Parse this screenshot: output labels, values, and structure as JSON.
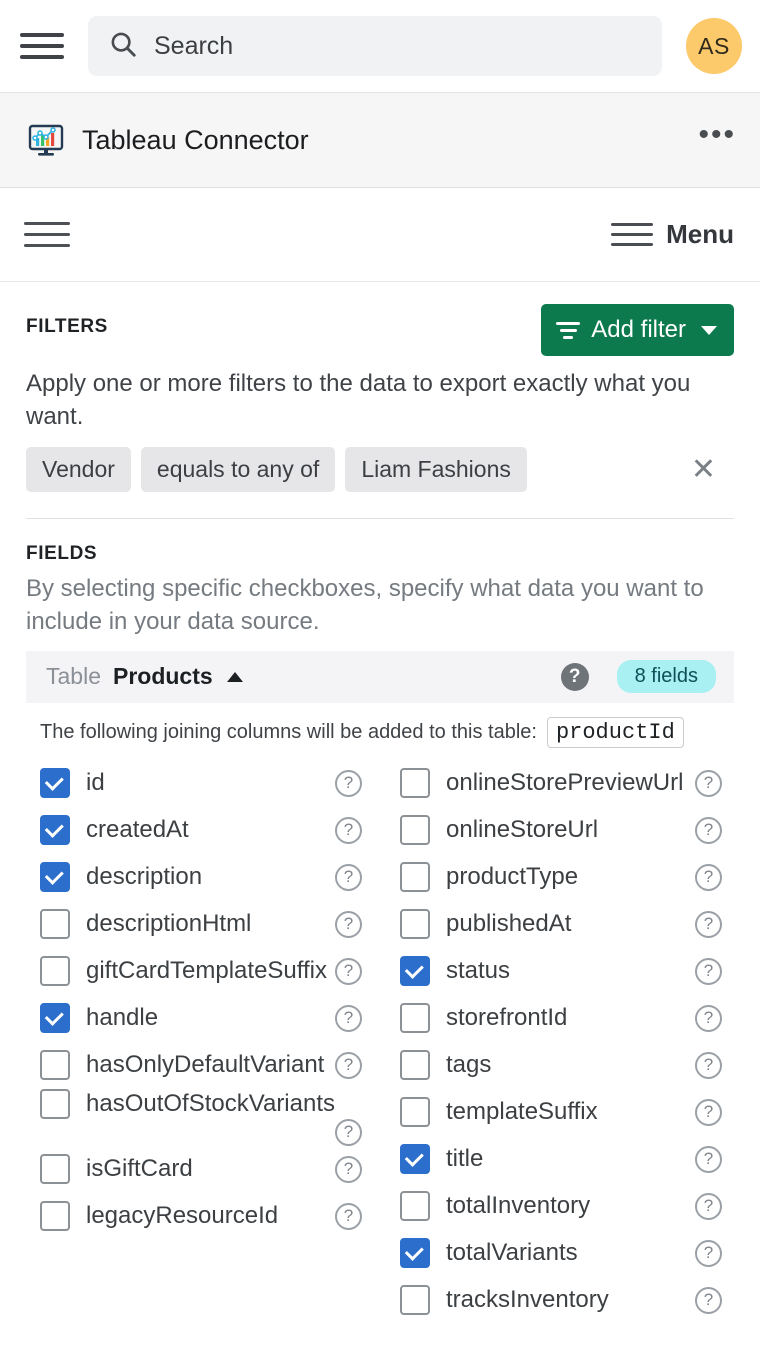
{
  "appbar": {
    "menu_icon": "hamburger-icon",
    "search": {
      "placeholder": "Search",
      "value": "",
      "icon": "search-icon"
    },
    "avatar": {
      "initials": "AS",
      "color": "#fcc96b"
    }
  },
  "titlebar": {
    "icon": "tableau-connector-icon",
    "title": "Tableau Connector",
    "overflow": "•••"
  },
  "toolbar": {
    "left_menu_icon": "hamburger-icon",
    "menu_label": "Menu"
  },
  "filters": {
    "section_title": "FILTERS",
    "add_button": "Add filter",
    "description": "Apply one or more filters to the data to export exactly what you want.",
    "chips": [
      {
        "label": "Vendor"
      },
      {
        "label": "equals to any of"
      },
      {
        "label": "Liam Fashions"
      }
    ],
    "remove_label": "✕",
    "accent_color": "#0c7a4d"
  },
  "fields": {
    "section_title": "FIELDS",
    "description": "By selecting specific checkboxes, specify what data you want to include in your data source.",
    "table": {
      "label": "Table",
      "name": "Products",
      "badge": "8 fields",
      "badge_color": "#a9f0f3",
      "help": "?"
    },
    "join_note": "The following joining columns will be added to this table:",
    "join_column": "productId",
    "help_glyph": "?",
    "left_column": [
      {
        "name": "id",
        "checked": true
      },
      {
        "name": "createdAt",
        "checked": true
      },
      {
        "name": "description",
        "checked": true
      },
      {
        "name": "descriptionHtml",
        "checked": false
      },
      {
        "name": "giftCardTemplateSuffix",
        "checked": false
      },
      {
        "name": "handle",
        "checked": true
      },
      {
        "name": "hasOnlyDefaultVariant",
        "checked": false
      },
      {
        "name": "hasOutOfStockVariants",
        "checked": false
      },
      {
        "name": "isGiftCard",
        "checked": false
      },
      {
        "name": "legacyResourceId",
        "checked": false
      }
    ],
    "right_column": [
      {
        "name": "onlineStorePreviewUrl",
        "checked": false
      },
      {
        "name": "onlineStoreUrl",
        "checked": false
      },
      {
        "name": "productType",
        "checked": false
      },
      {
        "name": "publishedAt",
        "checked": false
      },
      {
        "name": "status",
        "checked": true
      },
      {
        "name": "storefrontId",
        "checked": false
      },
      {
        "name": "tags",
        "checked": false
      },
      {
        "name": "templateSuffix",
        "checked": false
      },
      {
        "name": "title",
        "checked": true
      },
      {
        "name": "totalInventory",
        "checked": false
      },
      {
        "name": "totalVariants",
        "checked": true
      },
      {
        "name": "tracksInventory",
        "checked": false
      }
    ]
  }
}
